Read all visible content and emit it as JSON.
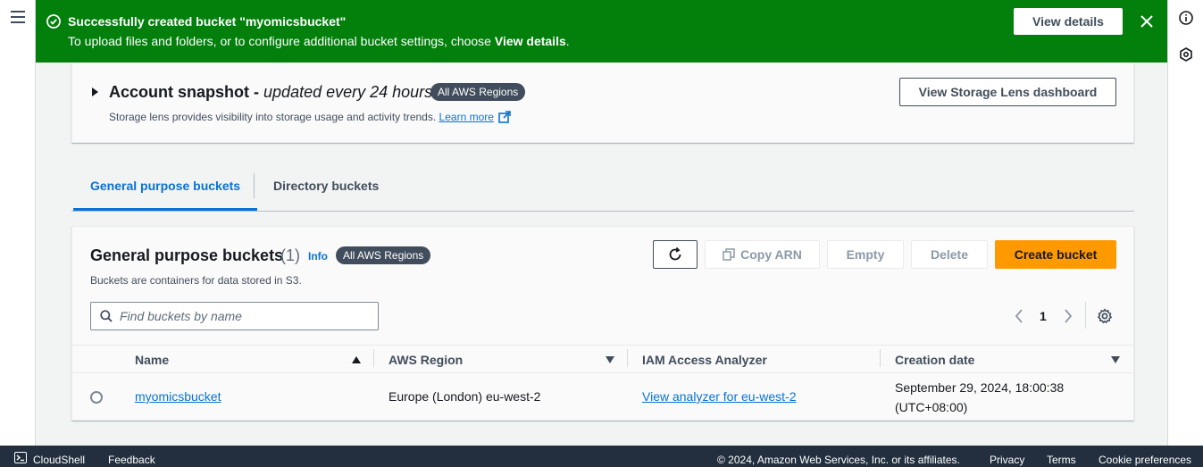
{
  "flash": {
    "title": "Successfully created bucket \"myomicsbucket\"",
    "message_prefix": "To upload files and folders, or to configure additional bucket settings, choose ",
    "message_bold": "View details",
    "message_suffix": ".",
    "view_details_label": "View details",
    "color": "#037f0c"
  },
  "snapshot": {
    "title": "Account snapshot -",
    "title_italic": "updated every 24 hours",
    "badge": "All AWS Regions",
    "description": "Storage lens provides visibility into storage usage and activity trends.",
    "learn_more": "Learn more",
    "lens_button": "View Storage Lens dashboard"
  },
  "tabs": [
    {
      "label": "General purpose buckets",
      "active": true
    },
    {
      "label": "Directory buckets",
      "active": false
    }
  ],
  "buckets": {
    "title": "General purpose buckets",
    "count": "(1)",
    "info": "Info",
    "badge": "All AWS Regions",
    "description": "Buckets are containers for data stored in S3.",
    "buttons": {
      "copy_arn": "Copy ARN",
      "empty": "Empty",
      "delete": "Delete",
      "create": "Create bucket"
    },
    "search_placeholder": "Find buckets by name",
    "page": "1",
    "columns": [
      "Name",
      "AWS Region",
      "IAM Access Analyzer",
      "Creation date"
    ],
    "rows": [
      {
        "name": "myomicsbucket",
        "region": "Europe (London) eu-west-2",
        "analyzer": "View analyzer for eu-west-2",
        "created_line1": "September 29, 2024, 18:00:38",
        "created_line2": "(UTC+08:00)"
      }
    ]
  },
  "footer": {
    "cloudshell": "CloudShell",
    "feedback": "Feedback",
    "copyright": "© 2024, Amazon Web Services, Inc. or its affiliates.",
    "privacy": "Privacy",
    "terms": "Terms",
    "cookies": "Cookie preferences"
  },
  "colors": {
    "accent": "#0972d3",
    "primary_button": "#ff9900",
    "footer": "#232f3e"
  }
}
